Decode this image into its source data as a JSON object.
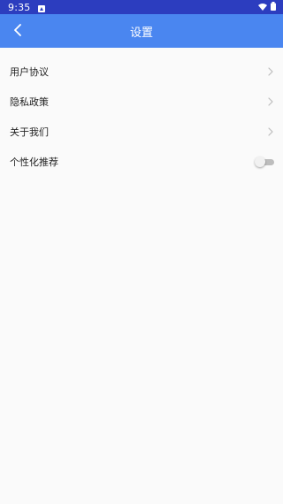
{
  "status_bar": {
    "time": "9:35",
    "notification_icon": "a-notification-icon",
    "wifi_icon": "wifi-icon",
    "battery_icon": "battery-icon"
  },
  "app_bar": {
    "title": "设置",
    "back_icon": "chevron-left-icon"
  },
  "settings": {
    "items": [
      {
        "label": "用户协议",
        "control": "chevron-right-icon"
      },
      {
        "label": "隐私政策",
        "control": "chevron-right-icon"
      },
      {
        "label": "关于我们",
        "control": "chevron-right-icon"
      },
      {
        "label": "个性化推荐",
        "control": "toggle",
        "toggle_on": false
      }
    ]
  },
  "colors": {
    "status_bar_bg": "#2c3dbf",
    "app_bar_bg": "#4a86f0",
    "page_bg": "#fafafa",
    "text": "#222222",
    "chevron": "#bdbdbd"
  }
}
